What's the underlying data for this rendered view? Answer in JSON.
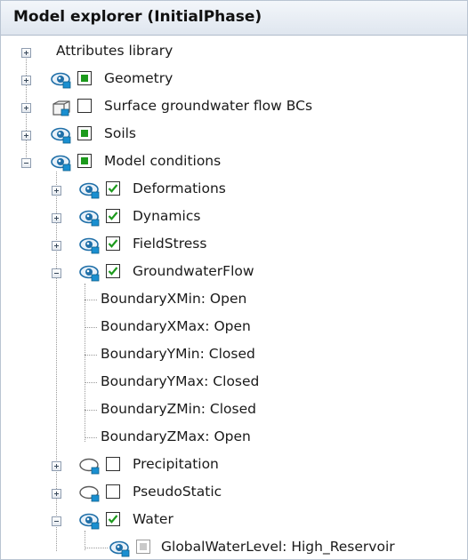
{
  "panel": {
    "title": "Model explorer (InitialPhase)"
  },
  "tree": {
    "attributes_library": "Attributes library",
    "geometry": "Geometry",
    "surface_gw_flow_bcs": "Surface groundwater flow BCs",
    "soils": "Soils",
    "model_conditions": "Model conditions",
    "deformations": "Deformations",
    "dynamics": "Dynamics",
    "fieldstress": "FieldStress",
    "groundwaterflow": "GroundwaterFlow",
    "gw_children": [
      "BoundaryXMin: Open",
      "BoundaryXMax: Open",
      "BoundaryYMin: Closed",
      "BoundaryYMax: Closed",
      "BoundaryZMin: Closed",
      "BoundaryZMax: Open"
    ],
    "precipitation": "Precipitation",
    "pseudostatic": "PseudoStatic",
    "water": "Water",
    "global_water_level": "GlobalWaterLevel: High_Reservoir"
  },
  "colors": {
    "accent_green": "#1c9a1c",
    "eye_blue": "#1f6fa8",
    "header_bg": "#dfe6ef"
  },
  "icons": [
    "plus-expander-icon",
    "minus-expander-icon",
    "eye-icon",
    "hidden-eye-icon",
    "checkbox-icon",
    "3d-box-icon"
  ]
}
